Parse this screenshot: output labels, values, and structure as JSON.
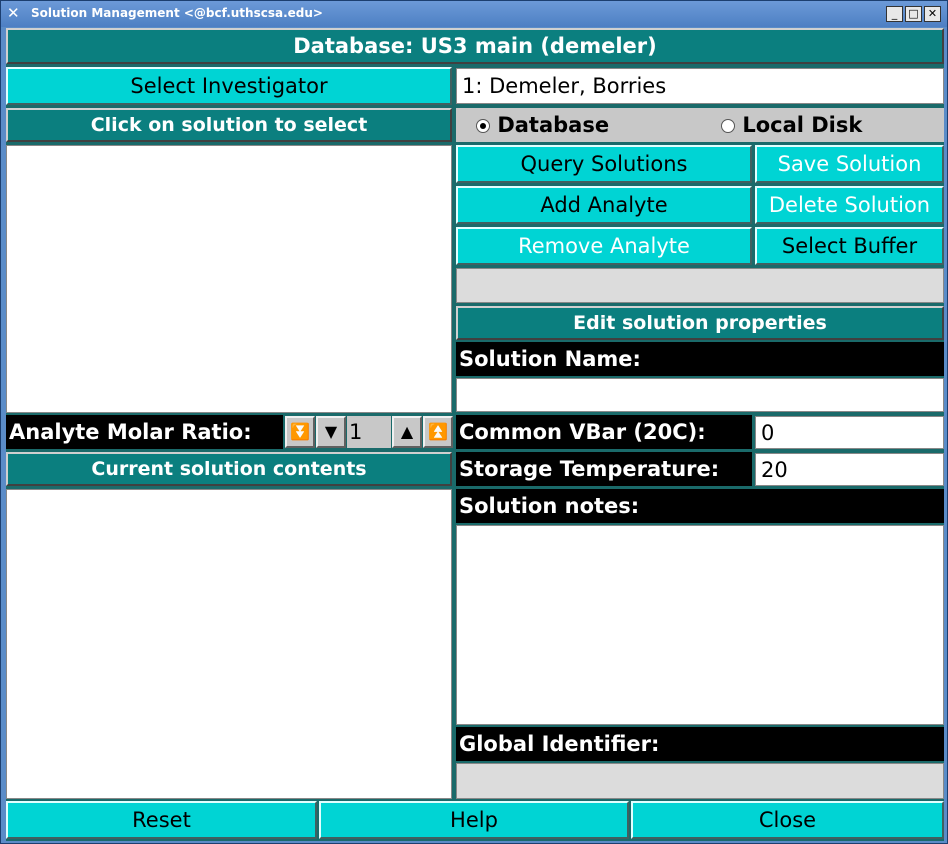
{
  "window": {
    "title": "Solution Management <@bcf.uthscsa.edu>",
    "app_icon": "x-icon"
  },
  "header": {
    "database_label": "Database: US3 main (demeler)"
  },
  "investigator": {
    "button_label": "Select Investigator",
    "value": "1: Demeler, Borries"
  },
  "solutions": {
    "banner": "Click on solution to select"
  },
  "source": {
    "database_label": "Database",
    "local_label": "Local Disk",
    "selected": "database"
  },
  "buttons": {
    "query": "Query Solutions",
    "save": "Save Solution",
    "add_analyte": "Add Analyte",
    "delete": "Delete Solution",
    "remove_analyte": "Remove Analyte",
    "select_buffer": "Select Buffer",
    "reset": "Reset",
    "help": "Help",
    "close": "Close"
  },
  "edit": {
    "banner": "Edit solution properties",
    "name_label": "Solution Name:",
    "name_value": "",
    "vbar_label": "Common VBar (20C):",
    "vbar_value": "0",
    "temp_label": "Storage Temperature:",
    "temp_value": "20",
    "notes_label": "Solution notes:",
    "gid_label": "Global Identifier:"
  },
  "analyte": {
    "ratio_label": "Analyte Molar Ratio:",
    "ratio_value": "1"
  },
  "contents": {
    "banner": "Current solution contents"
  }
}
